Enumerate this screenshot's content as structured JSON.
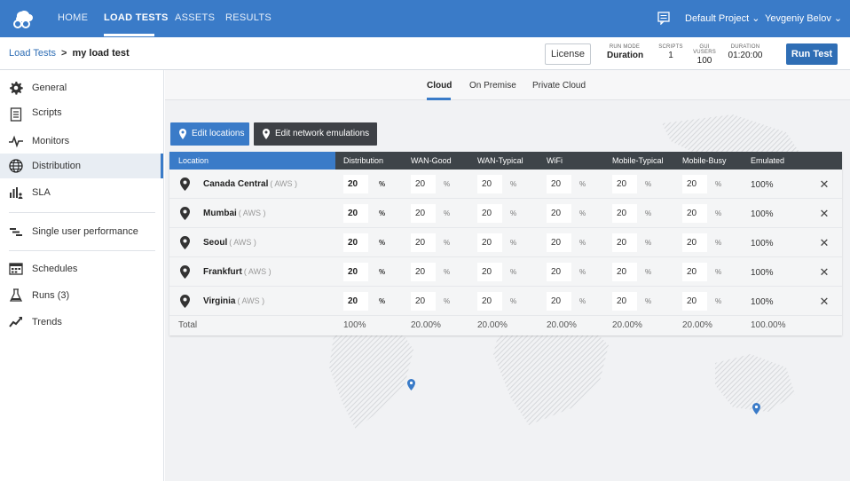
{
  "nav": {
    "items": [
      "HOME",
      "LOAD TESTS",
      "ASSETS",
      "RESULTS"
    ],
    "project": "Default Project",
    "user": "Yevgeniy Belov",
    "accent": "#3a7bc8"
  },
  "header": {
    "breadcrumb_link": "Load Tests",
    "breadcrumb_sep": ">",
    "breadcrumb_current": "my load test",
    "license_label": "License",
    "stats": [
      {
        "label": "RUN MODE",
        "value": "Duration"
      },
      {
        "label": "SCRIPTS",
        "value": "1"
      },
      {
        "label": "GUI VUSERS",
        "value": "100"
      },
      {
        "label": "DURATION",
        "value": "01:20:00"
      }
    ],
    "run_label": "Run Test"
  },
  "sidebar": {
    "items": [
      {
        "label": "General",
        "icon": "gear-icon"
      },
      {
        "label": "Scripts",
        "icon": "document-icon"
      },
      {
        "label": "Monitors",
        "icon": "pulse-icon"
      },
      {
        "label": "Distribution",
        "icon": "globe-icon"
      },
      {
        "label": "SLA",
        "icon": "bar-chart-person-icon"
      },
      {
        "label": "Single user performance",
        "icon": "timeline-bars-icon"
      },
      {
        "label": "Schedules",
        "icon": "calendar-grid-icon"
      },
      {
        "label": "Runs (3)",
        "icon": "flask-icon"
      },
      {
        "label": "Trends",
        "icon": "trend-icon"
      }
    ],
    "active": "Distribution"
  },
  "tabs": [
    "Cloud",
    "On Premise",
    "Private Cloud"
  ],
  "active_tab": "Cloud",
  "buttons": {
    "edit_locations": "Edit locations",
    "edit_network": "Edit network emulations"
  },
  "grid": {
    "headers": [
      "Location",
      "Distribution",
      "WAN-Good",
      "WAN-Typical",
      "WiFi",
      "Mobile-Typical",
      "Mobile-Busy",
      "Emulated"
    ],
    "percent_sign": "%",
    "delete_glyph": "✕",
    "rows": [
      {
        "name": "Canada Central",
        "provider": "( AWS )",
        "distribution": "20",
        "wan_good": "20",
        "wan_typical": "20",
        "wifi": "20",
        "mobile_typical": "20",
        "mobile_busy": "20",
        "emulated": "100%"
      },
      {
        "name": "Mumbai",
        "provider": "( AWS )",
        "distribution": "20",
        "wan_good": "20",
        "wan_typical": "20",
        "wifi": "20",
        "mobile_typical": "20",
        "mobile_busy": "20",
        "emulated": "100%"
      },
      {
        "name": "Seoul",
        "provider": "( AWS )",
        "distribution": "20",
        "wan_good": "20",
        "wan_typical": "20",
        "wifi": "20",
        "mobile_typical": "20",
        "mobile_busy": "20",
        "emulated": "100%"
      },
      {
        "name": "Frankfurt",
        "provider": "( AWS )",
        "distribution": "20",
        "wan_good": "20",
        "wan_typical": "20",
        "wifi": "20",
        "mobile_typical": "20",
        "mobile_busy": "20",
        "emulated": "100%"
      },
      {
        "name": "Virginia",
        "provider": "( AWS )",
        "distribution": "20",
        "wan_good": "20",
        "wan_typical": "20",
        "wifi": "20",
        "mobile_typical": "20",
        "mobile_busy": "20",
        "emulated": "100%"
      }
    ],
    "total": {
      "label": "Total",
      "distribution": "100%",
      "wan_good": "20.00%",
      "wan_typical": "20.00%",
      "wifi": "20.00%",
      "mobile_typical": "20.00%",
      "mobile_busy": "20.00%",
      "emulated": "100.00%"
    }
  }
}
